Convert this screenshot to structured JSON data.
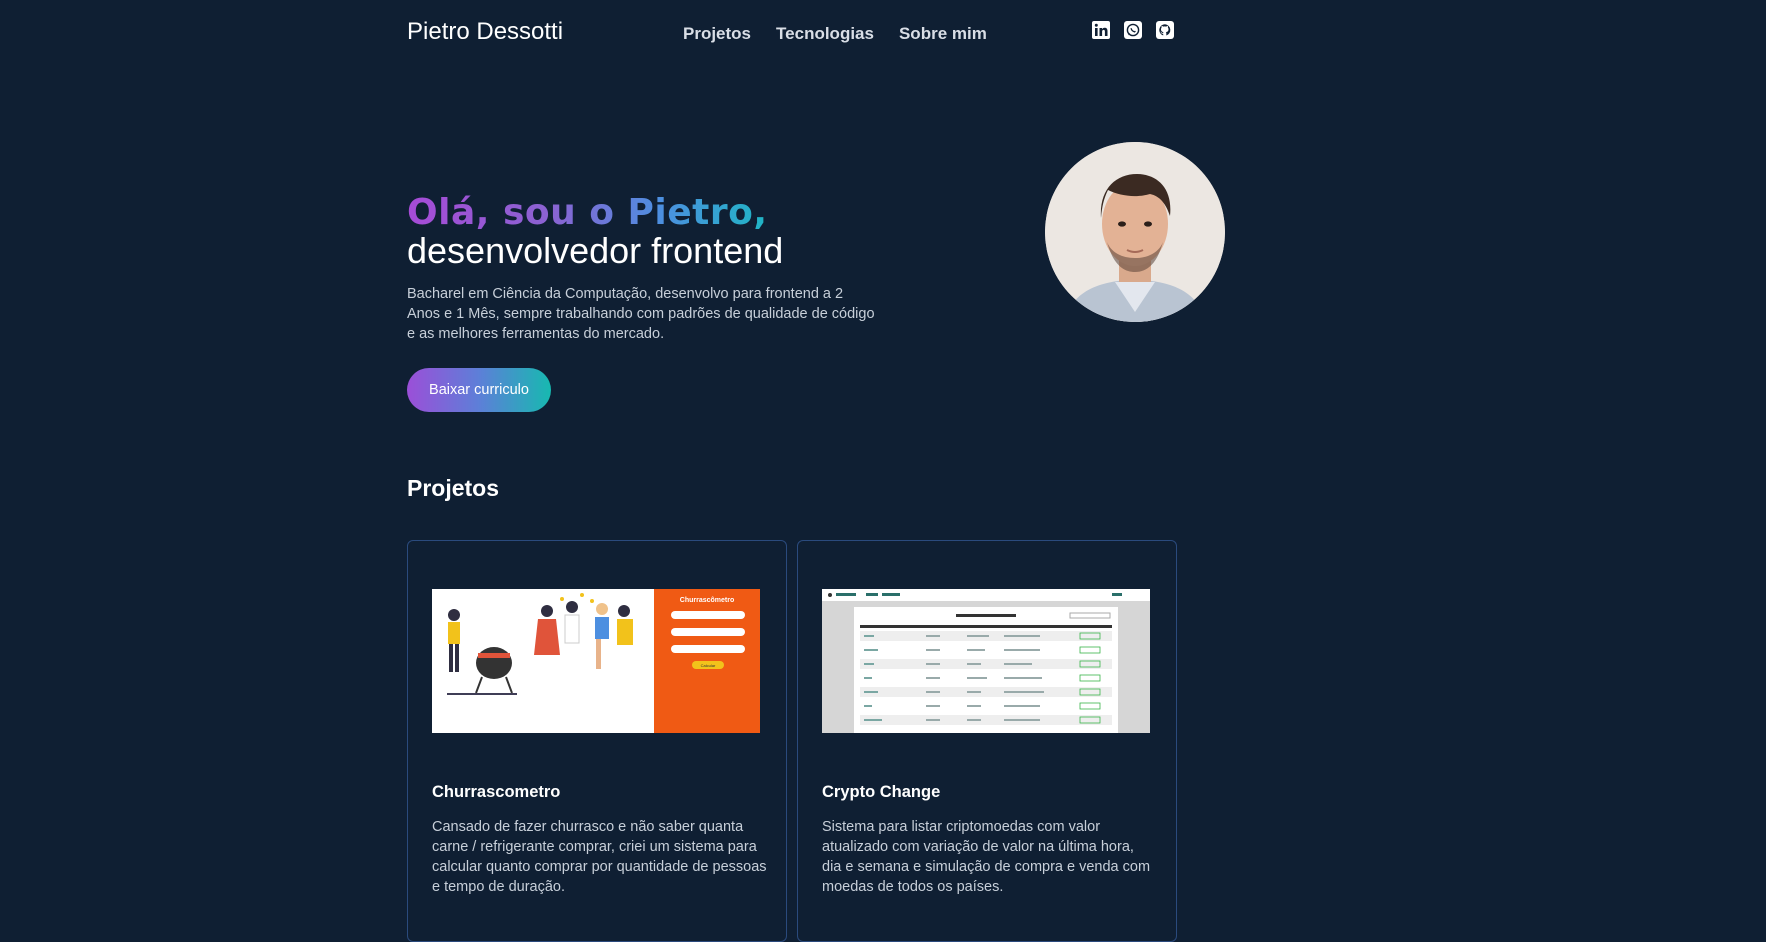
{
  "header": {
    "brand": "Pietro Dessotti",
    "nav": [
      "Projetos",
      "Tecnologias",
      "Sobre mim"
    ],
    "social_icons": [
      "linkedin-icon",
      "whatsapp-icon",
      "github-icon"
    ]
  },
  "hero": {
    "greeting": "Olá, sou o Pietro,",
    "role": "desenvolvedor frontend",
    "bio": "Bacharel em Ciência da Computação, desenvolvo para frontend a 2 Anos e 1 Mês, sempre trabalhando com padrões de qualidade de código e as melhores ferramentas do mercado.",
    "cv_button": "Baixar curriculo"
  },
  "projects": {
    "title": "Projetos",
    "items": [
      {
        "name": "Churrascometro",
        "description": "Cansado de fazer churrasco e não saber quanta carne / refrigerante comprar, criei um sistema para calcular quanto comprar por quantidade de pessoas e tempo de duração.",
        "thumb_title": "Churrascômetro",
        "thumb_button": "Calcular"
      },
      {
        "name": "Crypto Change",
        "description": "Sistema para listar criptomoedas com valor atualizado com variação de valor na última hora, dia e semana e simulação de compra e venda com moedas de todos os países."
      }
    ]
  },
  "colors": {
    "background": "#0f1f33",
    "card_border": "#2a4a7d",
    "accent_purple": "#9b4fd8",
    "accent_teal": "#17b9b0",
    "churrasco_orange": "#f05a14"
  }
}
